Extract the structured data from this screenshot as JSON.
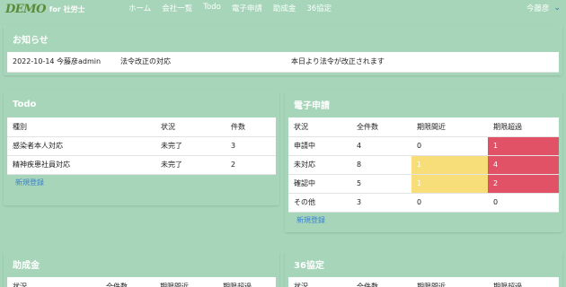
{
  "nav": {
    "logo_sub": "for 社労士",
    "links": [
      "ホーム",
      "会社一覧",
      "Todo",
      "電子申請",
      "助成金",
      "36協定"
    ],
    "user": "今藤彦"
  },
  "notice": {
    "title": "お知らせ",
    "rows": [
      {
        "date_author": "2022-10-14 今藤彦admin",
        "subject": "法令改正の対応",
        "body": "本日より法令が改正されます"
      }
    ]
  },
  "todo": {
    "title": "Todo",
    "headers": [
      "種別",
      "状況",
      "件数"
    ],
    "rows": [
      [
        "感染者本人対応",
        "未完了",
        "3"
      ],
      [
        "精神疾患社員対応",
        "未完了",
        "2"
      ]
    ],
    "new_link": "新規登録"
  },
  "denshi": {
    "title": "電子申請",
    "headers": [
      "状況",
      "全件数",
      "期限間近",
      "期限超過"
    ],
    "rows": [
      [
        "申請中",
        "4",
        "0",
        "1"
      ],
      [
        "未対応",
        "8",
        "1",
        "4"
      ],
      [
        "確認中",
        "5",
        "1",
        "2"
      ],
      [
        "その他",
        "3",
        "0",
        "0"
      ]
    ],
    "new_link": "新規登録"
  },
  "josei": {
    "title": "助成金",
    "headers": [
      "状況",
      "全件数",
      "期限間近",
      "期限超過"
    ]
  },
  "k36": {
    "title": "36協定",
    "headers": [
      "状況",
      "全件数",
      "期限間近",
      "期限超過"
    ]
  },
  "colors": {
    "brand": "#a6d5b9",
    "warn": "#f8de78",
    "alert": "#e25266",
    "link": "#3b7fd0"
  }
}
